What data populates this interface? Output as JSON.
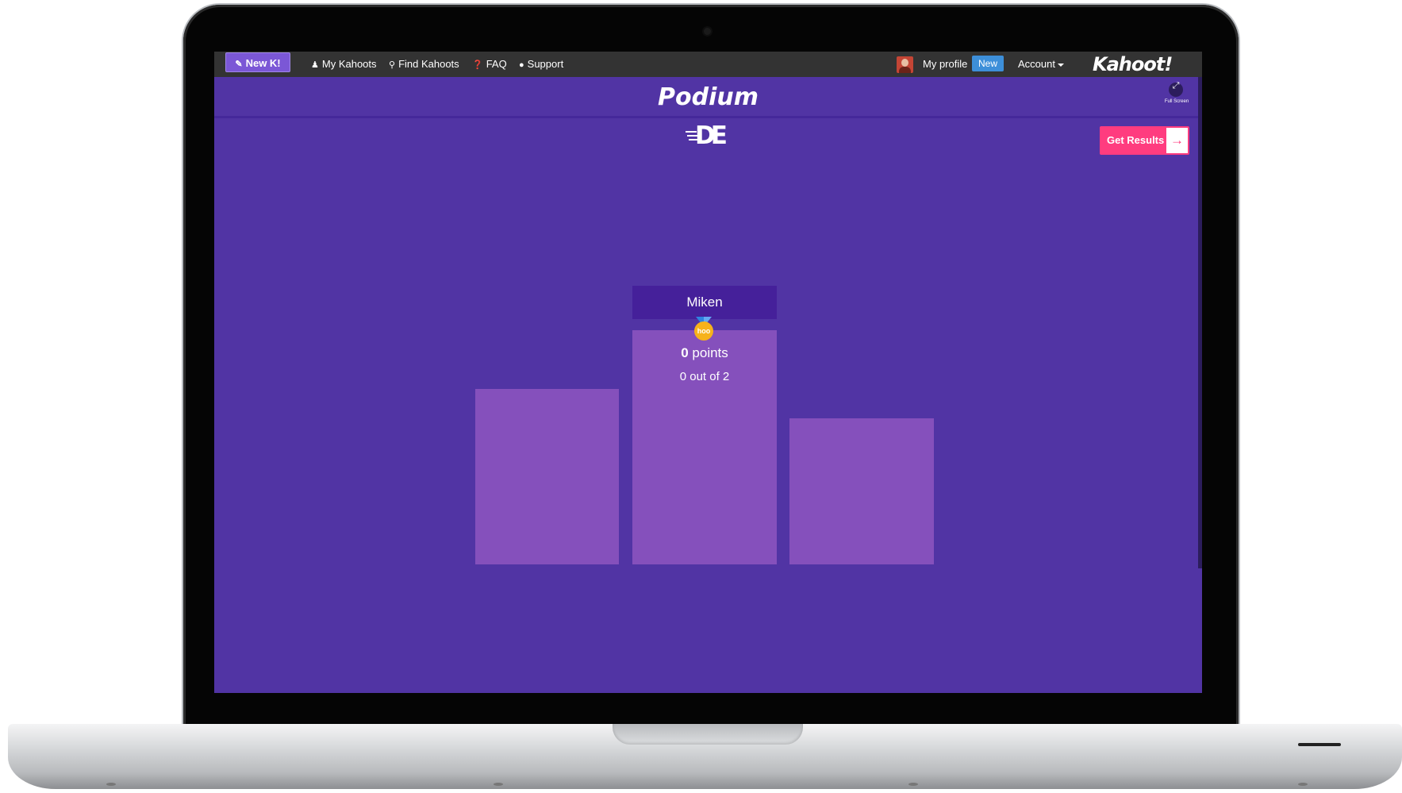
{
  "topbar": {
    "new_kahoot_label": "New K!",
    "nav": [
      {
        "label": "My Kahoots",
        "icon": "user-icon"
      },
      {
        "label": "Find Kahoots",
        "icon": "search-icon"
      },
      {
        "label": "FAQ",
        "icon": "question-circle-icon"
      },
      {
        "label": "Support",
        "icon": "chat-bubble-icon"
      }
    ],
    "profile_label": "My profile",
    "profile_badge": "New",
    "account_label": "Account",
    "brand": "Kahoot!"
  },
  "page": {
    "title": "Podium",
    "fullscreen_label": "Full Screen",
    "logo_text": "DE",
    "get_results_label": "Get Results",
    "get_results_icon": "arrow-right-icon",
    "background_color": "#5134a4",
    "accent_color": "#ff3c7f"
  },
  "podium": {
    "first": {
      "name": "Miken",
      "points_value": "0",
      "points_unit": "points",
      "correct": "0 out of 2",
      "medal_text": "hoo"
    }
  }
}
